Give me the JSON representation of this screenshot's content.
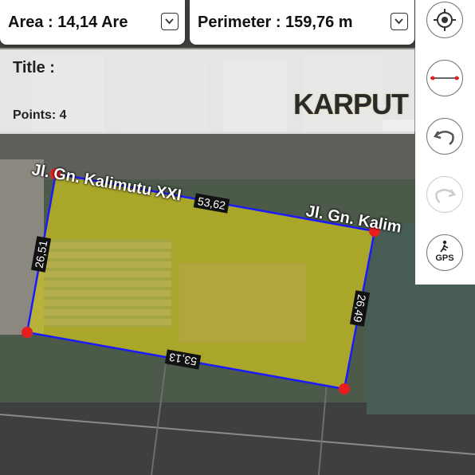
{
  "stats": {
    "area": "Area : 14,14 Are",
    "perimeter": "Perimeter : 159,76 m"
  },
  "info": {
    "title": "Title :",
    "points": "Points: 4",
    "logo": "KARPUT"
  },
  "toolbar": {
    "buttons": [
      "locate-icon",
      "measure-line-icon",
      "undo-icon",
      "redo-icon",
      "gps-icon"
    ],
    "gps_label": "GPS"
  },
  "map": {
    "streets": [
      "Jl. Gn. Kalimutu XXI",
      "Jl. Gn. Kalim"
    ],
    "edge_labels": [
      "53,62",
      "26,49",
      "53,13",
      "26,51"
    ],
    "polygon_color": "#c8c020",
    "edge_color": "#1a1aff",
    "vertex_color": "#e81e1e"
  }
}
